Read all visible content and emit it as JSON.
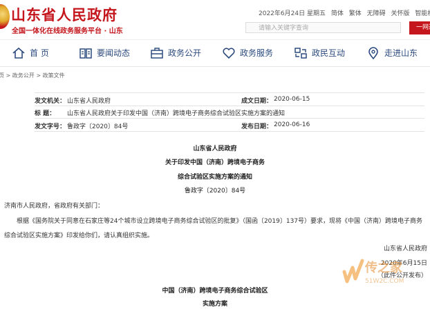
{
  "header": {
    "site_title": "山东省人民政府",
    "site_sub": "全国一体化在线政务服务平台 · 山东",
    "date": "2022年6月24日 星期五",
    "links": [
      "简体",
      "繁体",
      "无障碍",
      "关怀版",
      "智能机器人"
    ],
    "search_placeholder": "请输入关键字查询",
    "search_button": "一网通"
  },
  "nav": [
    {
      "label": "首 页",
      "icon": "home-icon"
    },
    {
      "label": "要闻动态",
      "icon": "book-icon"
    },
    {
      "label": "政务公开",
      "icon": "briefcase-icon"
    },
    {
      "label": "政务服务",
      "icon": "heart-icon"
    },
    {
      "label": "政民互动",
      "icon": "interaction-icon"
    },
    {
      "label": "走进山东",
      "icon": "location-icon"
    }
  ],
  "breadcrumb": "页 > 政务公开 > 政策文件",
  "meta": {
    "issuer_label": "发文机关：",
    "issuer": "山东省人民政府",
    "date_label": "成文日期：",
    "date": "2020-06-15",
    "title_label": "标      题：",
    "title": "山东省人民政府关于印发中国（济南）跨境电子商务综合试验区实施方案的通知",
    "docno_label": "发文字号：",
    "docno": "鲁政字〔2020〕84号",
    "pub_label": "发布日期：",
    "pub_date": "2020-06-16"
  },
  "doc": {
    "org": "山东省人民政府",
    "title1": "关于印发中国（济南）跨境电子商务",
    "title2": "综合试验区实施方案的通知",
    "number": "鲁政字〔2020〕84号",
    "addressee": "济南市人民政府，省政府有关部门：",
    "para1": "根据《国务院关于同意在石家庄等24个城市设立跨境电子商务综合试验区的批复》（国函〔2019〕137号）要求，现将《中国（济南）跨境电子商务",
    "para2": "综合试验区实施方案》印发给你们，请认真组织实施。",
    "sign_org": "山东省人民政府",
    "sign_date": "2020年6月15日",
    "sign_note": "（此件公开发布）",
    "sub_title": "中国（济南）跨境电子商务综合试验区",
    "sub_title2": "实施方案"
  },
  "watermark": {
    "text": "传之家",
    "domain": "51W2C.COM",
    "letter": "W"
  }
}
